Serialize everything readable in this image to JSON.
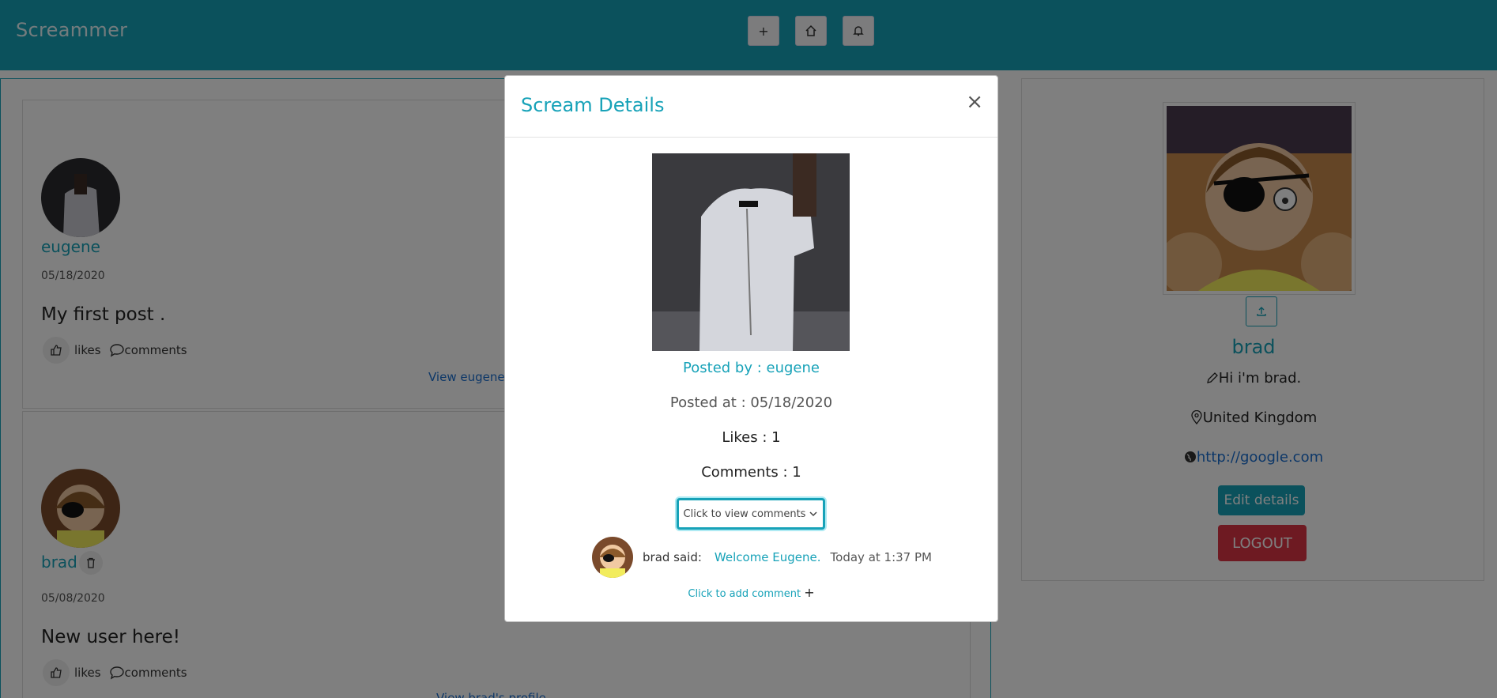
{
  "header": {
    "brand": "Screammer",
    "buttons": [
      {
        "name": "add-scream-button",
        "icon": "plus-icon",
        "glyph": "+"
      },
      {
        "name": "home-button",
        "icon": "home-icon"
      },
      {
        "name": "notifications-button",
        "icon": "bell-icon"
      }
    ]
  },
  "feed": {
    "posts": [
      {
        "username": "eugene",
        "date": "05/18/2020",
        "body": "My first post .",
        "likes_label": "likes",
        "comments_label": "comments",
        "profile_link": "View eugene's profile"
      },
      {
        "username": "brad",
        "date": "05/08/2020",
        "body": "New user here!",
        "likes_label": "likes",
        "comments_label": "comments",
        "profile_link": "View brad's profile"
      }
    ]
  },
  "profile": {
    "handle": "brad",
    "bio": "Hi i'm brad.",
    "location": "United Kingdom",
    "website": "http://google.com",
    "edit_label": "Edit details",
    "logout_label": "LOGOUT"
  },
  "modal": {
    "title": "Scream Details",
    "close_glyph": "×",
    "posted_by": "Posted by : eugene",
    "posted_at": "Posted at : 05/18/2020",
    "likes": "Likes : 1",
    "comments": "Comments : 1",
    "view_comments_label": "Click to view comments",
    "comment": {
      "user": "brad said:",
      "body": "Welcome Eugene.",
      "time": "Today at 1:37 PM"
    },
    "add_comment_label": "Click to add comment",
    "add_comment_glyph": "+"
  },
  "colors": {
    "primary": "#17a2b8",
    "danger": "#dc3545",
    "link": "#1a6fd1"
  }
}
